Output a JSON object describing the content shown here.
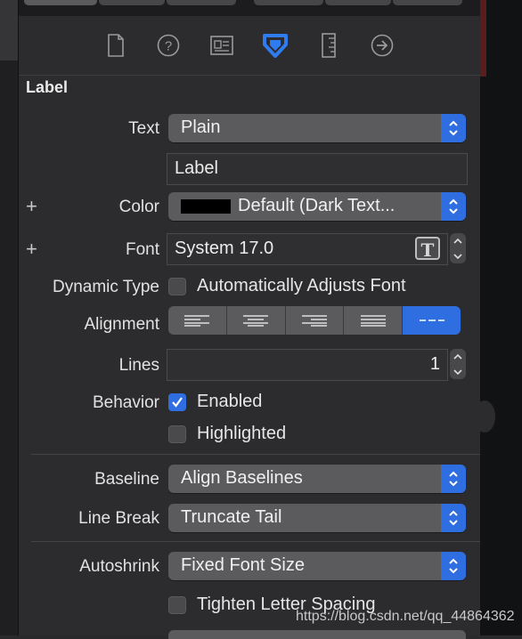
{
  "inspector": {
    "section_title": "Label",
    "tabs": [
      "file-icon",
      "help-icon",
      "identity-icon",
      "attributes-icon",
      "size-icon",
      "connections-icon"
    ],
    "active_tab": "attributes-icon",
    "accent_color": "#2f6ee0"
  },
  "text": {
    "label": "Text",
    "type_value": "Plain",
    "content_value": "Label"
  },
  "color": {
    "label": "Color",
    "value": "Default (Dark Text...",
    "swatch": "#000000"
  },
  "font": {
    "label": "Font",
    "value": "System 17.0",
    "picker_glyph": "T"
  },
  "dynamic_type": {
    "label": "Dynamic Type",
    "checkbox_label": "Automatically Adjusts Font",
    "checked": false
  },
  "alignment": {
    "label": "Alignment",
    "options": [
      "left-align-icon",
      "center-align-icon",
      "right-align-icon",
      "justify-align-icon",
      "natural-align-icon"
    ],
    "selected": "natural-align-icon"
  },
  "lines": {
    "label": "Lines",
    "value": "1"
  },
  "behavior": {
    "label": "Behavior",
    "enabled_label": "Enabled",
    "enabled": true,
    "highlighted_label": "Highlighted",
    "highlighted": false
  },
  "baseline": {
    "label": "Baseline",
    "value": "Align Baselines"
  },
  "line_break": {
    "label": "Line Break",
    "value": "Truncate Tail"
  },
  "autoshrink": {
    "label": "Autoshrink",
    "value": "Fixed Font Size",
    "tighten_label": "Tighten Letter Spacing",
    "tighten": false
  },
  "plus_glyph": "+",
  "watermark": "https://blog.csdn.net/qq_44864362"
}
